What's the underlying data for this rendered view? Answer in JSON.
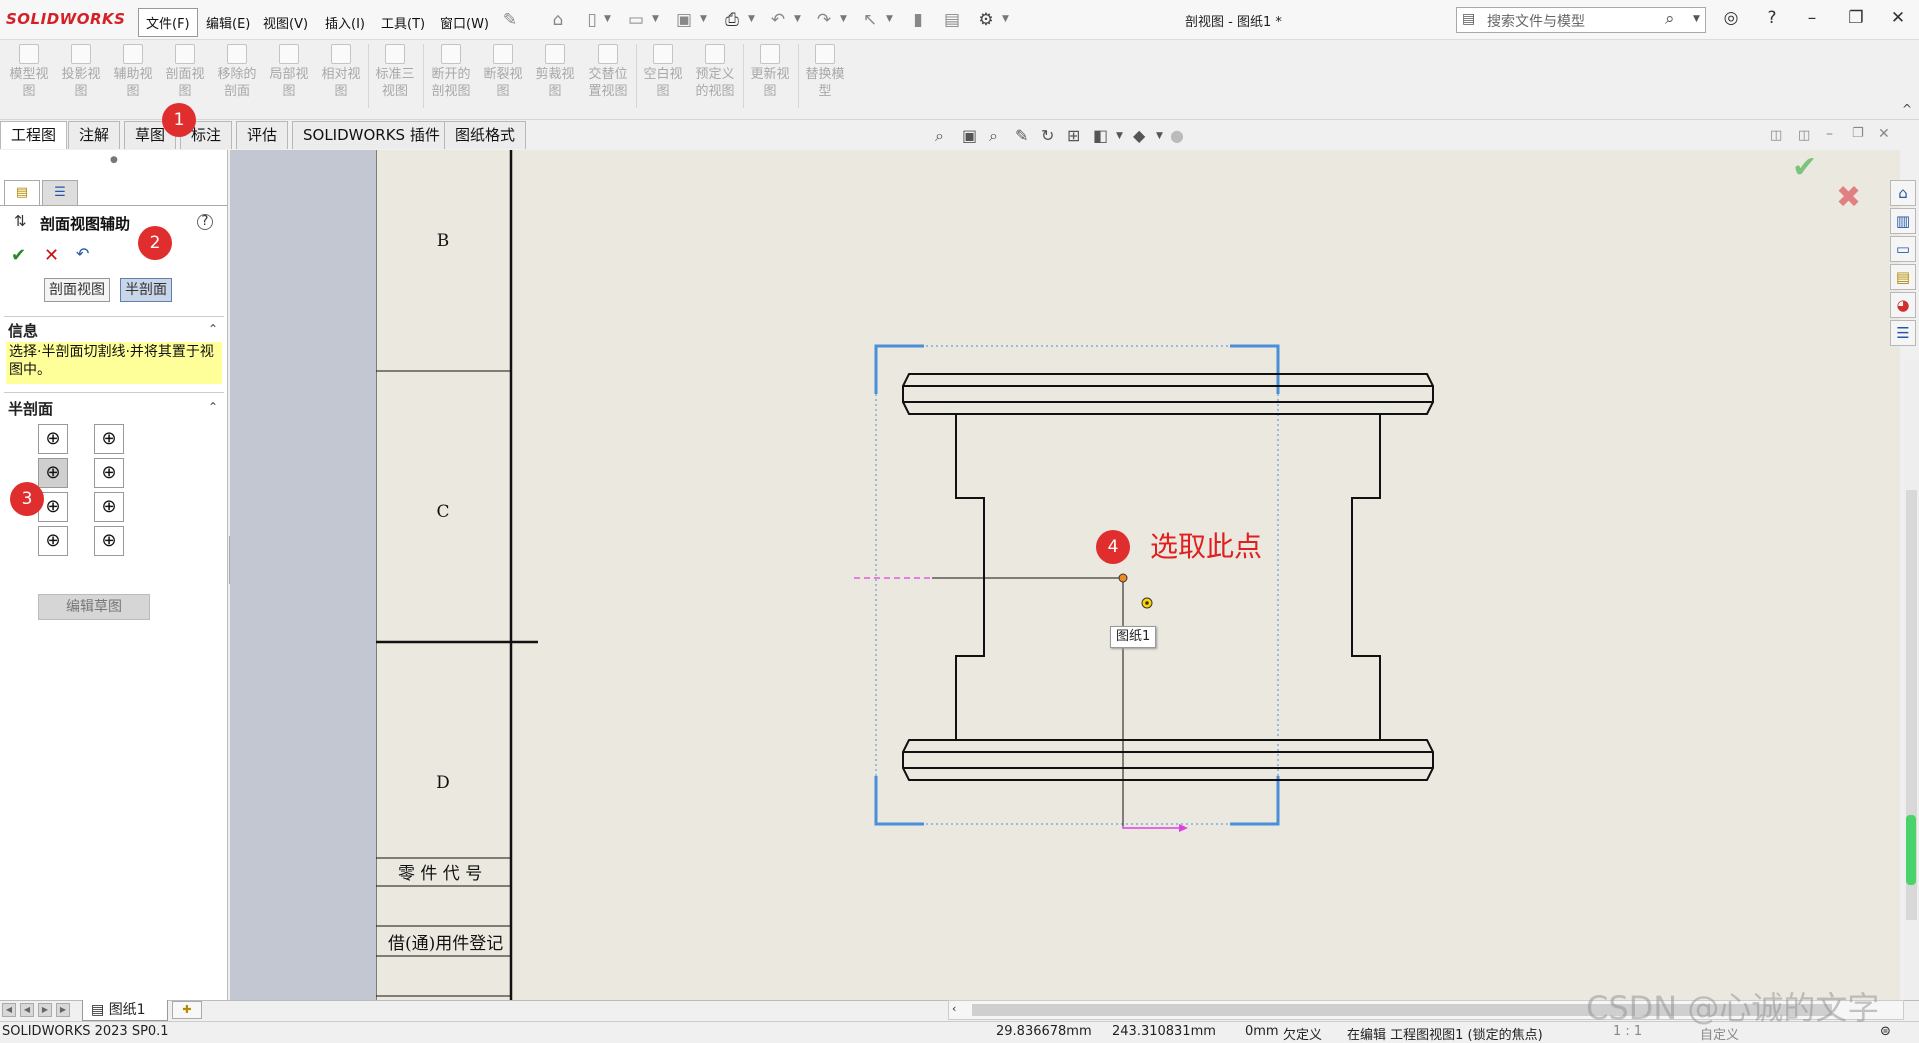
{
  "app": {
    "logo": "SOLIDWORKS",
    "document_title": "剖视图 - 图纸1 *"
  },
  "menus": [
    "文件(F)",
    "编辑(E)",
    "视图(V)",
    "插入(I)",
    "工具(T)",
    "窗口(W)"
  ],
  "search": {
    "placeholder": "搜索文件与模型"
  },
  "ribbon": {
    "buttons": [
      {
        "label": "模型视图",
        "icon": "model-view-icon"
      },
      {
        "label": "投影视图",
        "icon": "projected-view-icon"
      },
      {
        "label": "辅助视图",
        "icon": "auxiliary-view-icon"
      },
      {
        "label": "剖面视图",
        "icon": "section-view-icon"
      },
      {
        "label": "移除的剖面",
        "icon": "removed-section-icon"
      },
      {
        "label": "局部视图",
        "icon": "detail-view-icon"
      },
      {
        "label": "相对视图",
        "icon": "relative-view-icon"
      },
      {
        "label": "标准三视图",
        "icon": "standard-3-view-icon"
      },
      {
        "label": "断开的剖视图",
        "icon": "broken-out-section-icon"
      },
      {
        "label": "断裂视图",
        "icon": "break-view-icon"
      },
      {
        "label": "剪裁视图",
        "icon": "crop-view-icon"
      },
      {
        "label": "交替位置视图",
        "icon": "alternate-position-icon"
      },
      {
        "label": "空白视图",
        "icon": "empty-view-icon"
      },
      {
        "label": "预定义的视图",
        "icon": "predefined-view-icon"
      },
      {
        "label": "更新视图",
        "icon": "update-view-icon"
      },
      {
        "label": "替换模型",
        "icon": "replace-model-icon"
      }
    ]
  },
  "tabs": [
    "工程图",
    "注解",
    "草图",
    "标注",
    "评估",
    "SOLIDWORKS 插件",
    "图纸格式"
  ],
  "property_manager": {
    "title": "剖面视图辅助",
    "mode_buttons": [
      "剖面视图",
      "半剖面"
    ],
    "active_mode": "半剖面",
    "info_header": "信息",
    "info_text": "选择·半剖面切割线·并将其置于视图中。",
    "half_section_header": "半剖面",
    "half_section_options": [
      "top-right",
      "top-left",
      "bottom-right",
      "bottom-left",
      "right-down",
      "left-down",
      "right-up",
      "left-up"
    ],
    "edit_sketch_label": "编辑草图"
  },
  "drawing": {
    "zone_labels": [
      "B",
      "C",
      "D"
    ],
    "table_rows": [
      "零 件 代 号",
      "借(通)用件登记"
    ],
    "tooltip": "图纸1"
  },
  "annotations": {
    "badges": [
      "1",
      "2",
      "3",
      "4"
    ],
    "callout_text": "选取此点"
  },
  "sheet_tabs": {
    "current": "图纸1"
  },
  "status": {
    "version": "SOLIDWORKS 2023 SP0.1",
    "x": "29.836678mm",
    "y": "243.310831mm",
    "z": "0mm",
    "definition": "欠定义",
    "editing": "在编辑 工程图视图1 (锁定的焦点)",
    "scale": "1 : 1",
    "units": "自定义"
  },
  "watermark": "CSDN @心诚的文字",
  "colors": {
    "accent_red": "#e02d2d",
    "info_yellow": "#ffff99",
    "selection_blue": "#4a90d9",
    "sheet_bg": "#ebe9df"
  }
}
